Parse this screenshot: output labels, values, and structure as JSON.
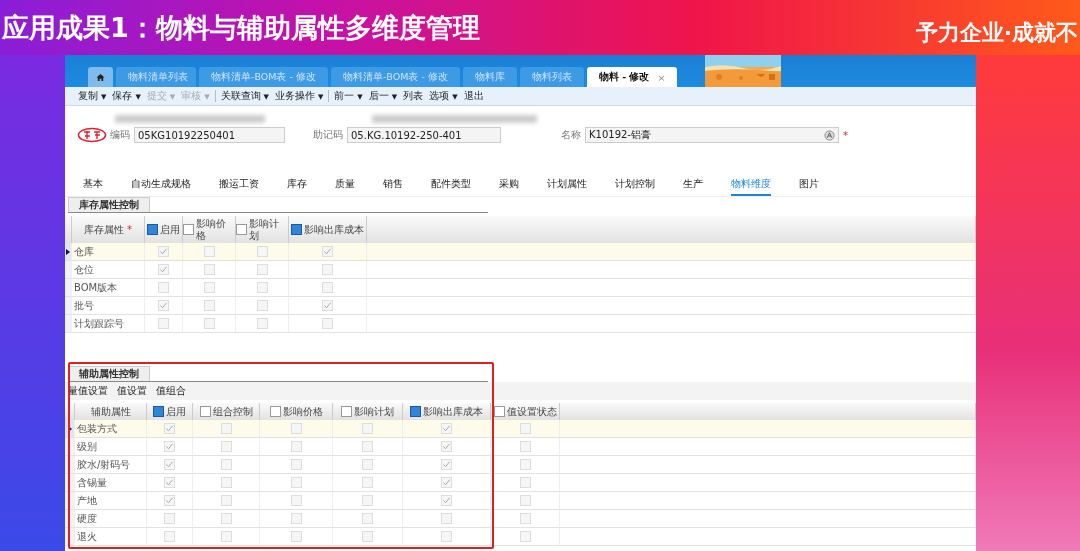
{
  "slide": {
    "title": "应用成果1：物料与辅助属性多维度管理",
    "slogan": "予力企业·成就不"
  },
  "tabs": [
    {
      "kind": "home",
      "selected": false
    },
    {
      "kind": "text",
      "label": "物料清单列表",
      "selected": false
    },
    {
      "kind": "text",
      "label": "物料清单-BOM表 - 修改",
      "selected": false
    },
    {
      "kind": "text",
      "label": "物料清单-BOM表 - 修改",
      "selected": false
    },
    {
      "kind": "text",
      "label": "物料库",
      "selected": false
    },
    {
      "kind": "text",
      "label": "物料列表",
      "selected": false
    },
    {
      "kind": "text",
      "label": "物料 - 修改",
      "selected": true,
      "close": "×"
    }
  ],
  "toolbar": [
    [
      {
        "label": "复制",
        "dropdown": "▼",
        "disabled": false
      },
      {
        "label": "保存",
        "dropdown": "▼",
        "disabled": false
      },
      {
        "label": "提交",
        "dropdown": "▼",
        "disabled": true
      },
      {
        "label": "审核",
        "dropdown": "▼",
        "disabled": true
      }
    ],
    [
      {
        "label": "关联查询",
        "dropdown": "▼",
        "disabled": false
      },
      {
        "label": "业务操作",
        "dropdown": "▼",
        "disabled": false
      }
    ],
    [
      {
        "label": "前一",
        "dropdown": "▼",
        "disabled": false
      },
      {
        "label": "后一",
        "dropdown": "▼",
        "disabled": false
      },
      {
        "label": "列表",
        "disabled": false
      },
      {
        "label": "选项",
        "dropdown": "▼",
        "disabled": false
      },
      {
        "label": "退出",
        "disabled": false
      }
    ]
  ],
  "fields": [
    {
      "label": "编码",
      "value": "05KG10192250401"
    },
    {
      "label": "助记码",
      "value": "05.KG.10192-250-401"
    },
    {
      "label": "名称",
      "value": "K10192-铝膏",
      "lookup": true,
      "required_mark": "*"
    }
  ],
  "form_tabs": [
    {
      "label": "基本",
      "selected": false
    },
    {
      "label": "自动生成规格",
      "selected": false
    },
    {
      "label": "搬运工资",
      "selected": false
    },
    {
      "label": "库存",
      "selected": false
    },
    {
      "label": "质量",
      "selected": false
    },
    {
      "label": "销售",
      "selected": false
    },
    {
      "label": "配件类型",
      "selected": false
    },
    {
      "label": "采购",
      "selected": false
    },
    {
      "label": "计划属性",
      "selected": false
    },
    {
      "label": "计划控制",
      "selected": false
    },
    {
      "label": "生产",
      "selected": false
    },
    {
      "label": "物料维度",
      "selected": true
    },
    {
      "label": "图片",
      "selected": false
    }
  ],
  "stock_section": {
    "title": "库存属性控制",
    "columns": [
      {
        "label": "库存属性",
        "required_mark": "*"
      },
      {
        "label": "启用",
        "checked": true
      },
      {
        "label": "影响价格",
        "checked": false
      },
      {
        "label": "影响计划",
        "checked": false
      },
      {
        "label": "影响出库成本",
        "checked": true
      }
    ],
    "rows": [
      {
        "name": "仓库",
        "selected": true,
        "checks": [
          true,
          false,
          false,
          true
        ]
      },
      {
        "name": "仓位",
        "selected": false,
        "checks": [
          true,
          false,
          false,
          false
        ]
      },
      {
        "name": "BOM版本",
        "selected": false,
        "checks": [
          false,
          false,
          false,
          false
        ]
      },
      {
        "name": "批号",
        "selected": false,
        "checks": [
          true,
          false,
          false,
          true
        ]
      },
      {
        "name": "计划跟踪号",
        "selected": false,
        "checks": [
          false,
          false,
          false,
          false
        ]
      }
    ]
  },
  "aux_section": {
    "title": "辅助属性控制",
    "highlighted": true,
    "toolbar": [
      "量值设置",
      "值设置",
      "值组合"
    ],
    "columns": [
      {
        "label": "辅助属性"
      },
      {
        "label": "启用",
        "checked": true
      },
      {
        "label": "组合控制",
        "checked": false
      },
      {
        "label": "影响价格",
        "checked": false
      },
      {
        "label": "影响计划",
        "checked": false
      },
      {
        "label": "影响出库成本",
        "checked": true
      },
      {
        "label": "值设置状态",
        "checked": false
      }
    ],
    "rows": [
      {
        "name": "包装方式",
        "selected": true,
        "checks": [
          true,
          false,
          false,
          false,
          true,
          false
        ]
      },
      {
        "name": "级别",
        "selected": false,
        "checks": [
          true,
          false,
          false,
          false,
          true,
          false
        ]
      },
      {
        "name": "胶水/射码号",
        "selected": false,
        "checks": [
          true,
          false,
          false,
          false,
          true,
          false
        ]
      },
      {
        "name": "含锡量",
        "selected": false,
        "checks": [
          true,
          false,
          false,
          false,
          true,
          false
        ]
      },
      {
        "name": "产地",
        "selected": false,
        "checks": [
          true,
          false,
          false,
          false,
          true,
          false
        ]
      },
      {
        "name": "硬度",
        "selected": false,
        "checks": [
          false,
          false,
          false,
          false,
          false,
          false
        ]
      },
      {
        "name": "退火",
        "selected": false,
        "checks": [
          false,
          false,
          false,
          false,
          false,
          false
        ]
      }
    ]
  }
}
